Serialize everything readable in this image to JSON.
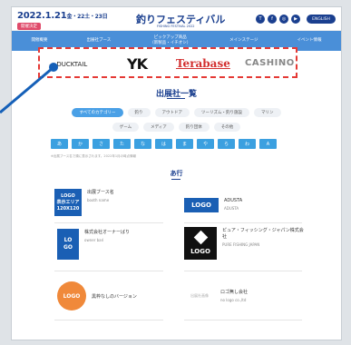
{
  "header": {
    "date": "2022.1.21",
    "date_suffix": "金・22土・23日",
    "badge": "開催決定",
    "title": "釣りフェスティバル",
    "subtitle": "FISHING FESTIVAL 2022",
    "social": [
      "T",
      "f",
      "◎",
      "▶"
    ],
    "lang_button": "ENGLISH"
  },
  "nav": {
    "items": [
      "開催概要",
      "出展社ブース",
      "ピックアップ商品\n（新製品・イチオシ）",
      "メインステージ",
      "イベント情報"
    ]
  },
  "sponsors": {
    "items": [
      "DUCKTAIL",
      "YK",
      "Terabase",
      "CASHINO"
    ]
  },
  "section": {
    "title": "出展社一覧"
  },
  "categories": {
    "row1": [
      "すべてのカテゴリー",
      "釣り",
      "アウトドア",
      "ツーリズム・釣り施設",
      "マリン"
    ],
    "row2": [
      "ゲーム",
      "メディア",
      "釣り団体",
      "その他"
    ],
    "active": "すべてのカテゴリー"
  },
  "kana": [
    "あ",
    "か",
    "さ",
    "た",
    "な",
    "は",
    "ま",
    "や",
    "ら",
    "わ",
    "A"
  ],
  "notice": "※出展ブース名で順に表示されます。2022年1月の時点情報",
  "row_heading": "あ行",
  "cards": [
    {
      "thumb": "LOGO\n表示エリア\n120X120",
      "thumb_color": "#1a5fb4",
      "name": "出展ブース名",
      "sub": "booth name"
    },
    {
      "thumb": "LOGO",
      "thumb_color": "#1a5fb4",
      "name": "ADUSTA",
      "sub": "ADUSTA"
    },
    {
      "thumb": "LO\nGO",
      "thumb_color": "#1a5fb4",
      "name": "株式会社オーナーばり",
      "sub": "owner bari"
    },
    {
      "thumb": "LOGO",
      "thumb_color": "#111111",
      "name": "ピュア・フィッシング・ジャパン株式会社",
      "sub": "PURE FISHING JAPAN"
    },
    {
      "thumb": "LOGO",
      "thumb_color": "#f0893a",
      "name": "黒枠なしのバージョン",
      "sub": ""
    },
    {
      "thumb": "出展社画像",
      "thumb_color": "#ffffff",
      "name": "ロゴ無し会社",
      "sub": "no logo co.,ltd"
    }
  ]
}
